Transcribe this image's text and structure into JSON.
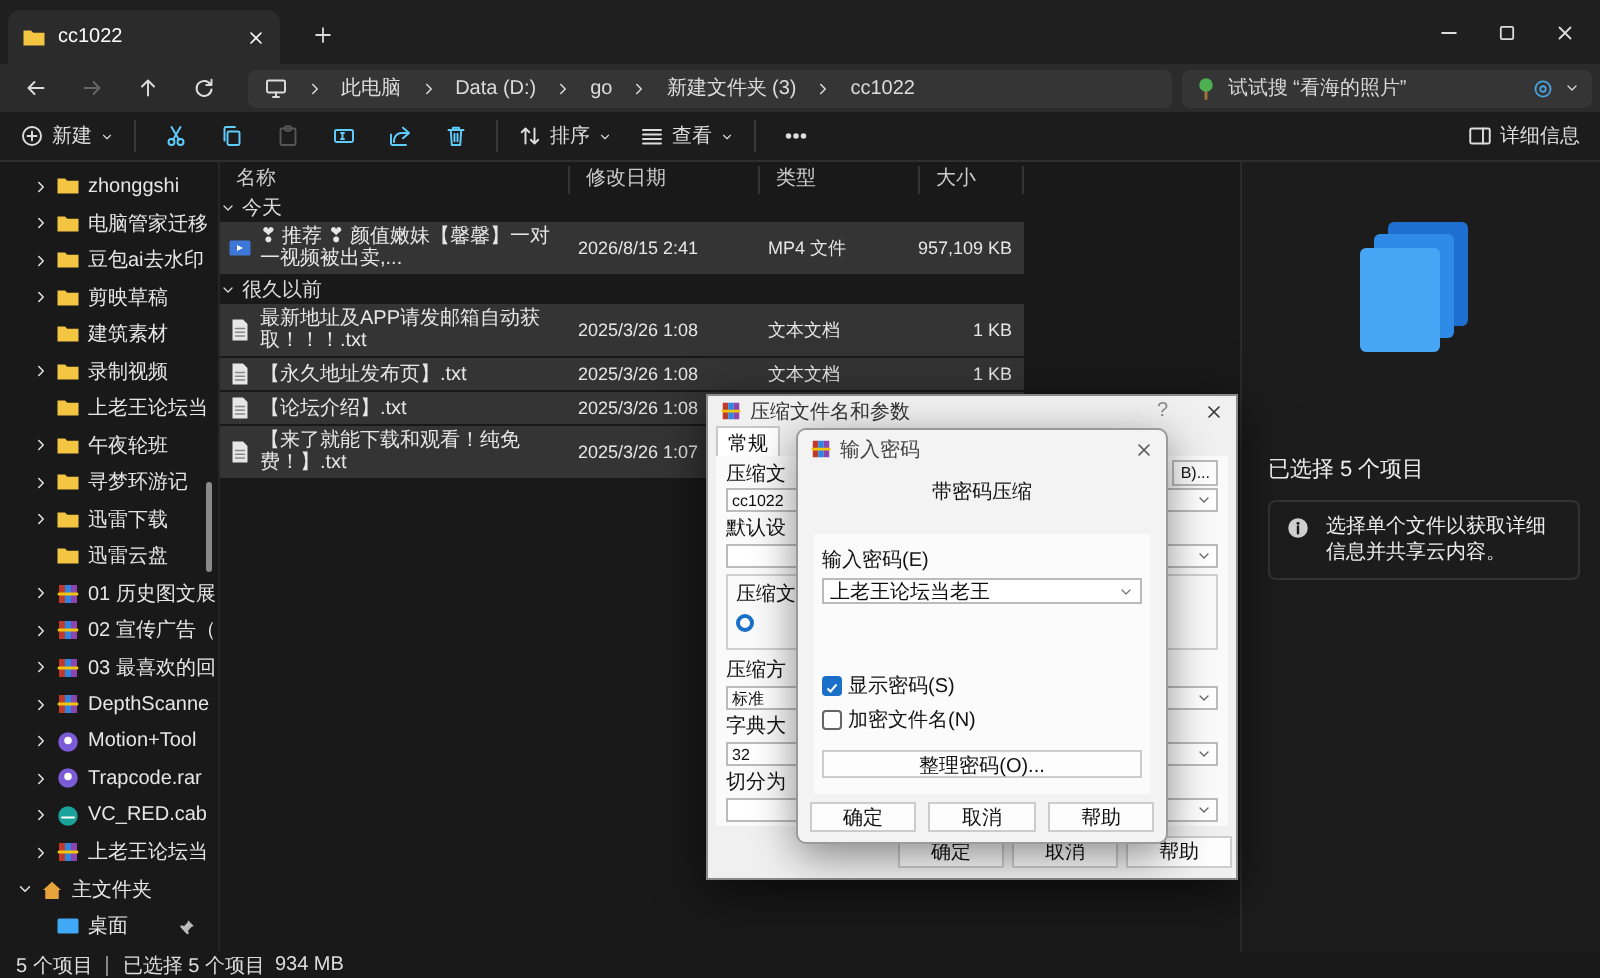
{
  "tabs": [
    {
      "label": "cc1022",
      "selected": true
    }
  ],
  "address_bar": {
    "breadcrumb": [
      "此电脑",
      "Data (D:)",
      "go",
      "新建文件夹 (3)",
      "cc1022"
    ],
    "search": {
      "placeholder": "试试搜 “看海的照片”"
    }
  },
  "toolbar": {
    "new": "新建",
    "sort": "排序",
    "view": "查看",
    "details": "详细信息"
  },
  "sidebar": {
    "items": [
      {
        "label": "zhonggshi",
        "kind": "folder",
        "expanded": false
      },
      {
        "label": "电脑管家迁移",
        "kind": "folder",
        "expanded": false
      },
      {
        "label": "豆包ai去水印",
        "kind": "folder",
        "expanded": false
      },
      {
        "label": "剪映草稿",
        "kind": "folder",
        "expanded": false
      },
      {
        "label": "建筑素材",
        "kind": "folder"
      },
      {
        "label": "录制视频",
        "kind": "folder",
        "expanded": false
      },
      {
        "label": "上老王论坛当",
        "kind": "folder"
      },
      {
        "label": "午夜轮班",
        "kind": "folder",
        "expanded": false
      },
      {
        "label": "寻梦环游记",
        "kind": "folder",
        "expanded": false
      },
      {
        "label": "迅雷下载",
        "kind": "folder",
        "expanded": false
      },
      {
        "label": "迅雷云盘",
        "kind": "folder"
      },
      {
        "label": "01 历史图文展",
        "kind": "archive",
        "expanded": false
      },
      {
        "label": "02 宣传广告（",
        "kind": "archive",
        "expanded": false
      },
      {
        "label": "03 最喜欢的回",
        "kind": "archive",
        "expanded": false
      },
      {
        "label": "DepthScanne",
        "kind": "archive",
        "expanded": false
      },
      {
        "label": "Motion+Tool",
        "kind": "disc",
        "expanded": false
      },
      {
        "label": "Trapcode.rar",
        "kind": "disc",
        "expanded": false
      },
      {
        "label": "VC_RED.cab",
        "kind": "cab",
        "expanded": false
      },
      {
        "label": "上老王论坛当",
        "kind": "archive",
        "expanded": false
      },
      {
        "label": "主文件夹",
        "kind": "home",
        "expanded": true,
        "children": [
          {
            "label": "桌面",
            "kind": "desktop",
            "pinned": true
          }
        ]
      }
    ]
  },
  "file_list": {
    "columns": [
      "名称",
      "修改日期",
      "类型",
      "大小"
    ],
    "groups": [
      {
        "label": "今天",
        "expanded": true,
        "rows": [
          {
            "name": "❣ 推荐 ❣ 颜值嫩妹【馨馨】一对一视频被出卖,...",
            "date": "2026/8/15 2:41",
            "type": "MP4 文件",
            "size": "957,109 KB",
            "kind": "video",
            "selected": true
          }
        ]
      },
      {
        "label": "很久以前",
        "expanded": true,
        "rows": [
          {
            "name": "最新地址及APP请发邮箱自动获取！！！.txt",
            "date": "2025/3/26 1:08",
            "type": "文本文档",
            "size": "1 KB",
            "kind": "text",
            "selected": true
          },
          {
            "name": "【永久地址发布页】.txt",
            "date": "2025/3/26 1:08",
            "type": "文本文档",
            "size": "1 KB",
            "kind": "text",
            "selected": true
          },
          {
            "name": "【论坛介绍】.txt",
            "date": "2025/3/26 1:08",
            "kind": "text",
            "selected": true
          },
          {
            "name": "【来了就能下载和观看！纯免费！】.txt",
            "date": "2025/3/26 1:07",
            "kind": "text",
            "selected": true
          }
        ]
      }
    ]
  },
  "details_pane": {
    "title": "已选择 5 个项目",
    "info": "选择单个文件以获取详细信息并共享云内容。"
  },
  "status_bar": {
    "count": "5 个项目",
    "selection": "已选择 5 个项目",
    "size": "934 MB"
  },
  "archive_dialog": {
    "title": "压缩文件名和参数",
    "help": "?",
    "tabs": [
      {
        "label": "常规",
        "selected": true
      }
    ],
    "archive_name_label": "压缩文",
    "browse_button": "B)...",
    "archive_name": "cc1022",
    "profile_label": "默认设",
    "format_group_label": "压缩文",
    "format_radio": {
      "selected": true
    },
    "method_label": "压缩方",
    "method": "标准",
    "dictionary_label": "字典大",
    "dictionary": "32",
    "split_label": "切分为",
    "buttons": [
      "确定",
      "取消",
      "帮助"
    ]
  },
  "password_dialog": {
    "title": "输入密码",
    "heading": "带密码压缩",
    "password_label": "输入密码(E)",
    "password": "上老王论坛当老王",
    "show_password": {
      "label": "显示密码(S)",
      "checked": true
    },
    "encrypt_names": {
      "label": "加密文件名(N)",
      "checked": false
    },
    "organize_button": "整理密码(O)...",
    "buttons": [
      "确定",
      "取消",
      "帮助"
    ]
  }
}
